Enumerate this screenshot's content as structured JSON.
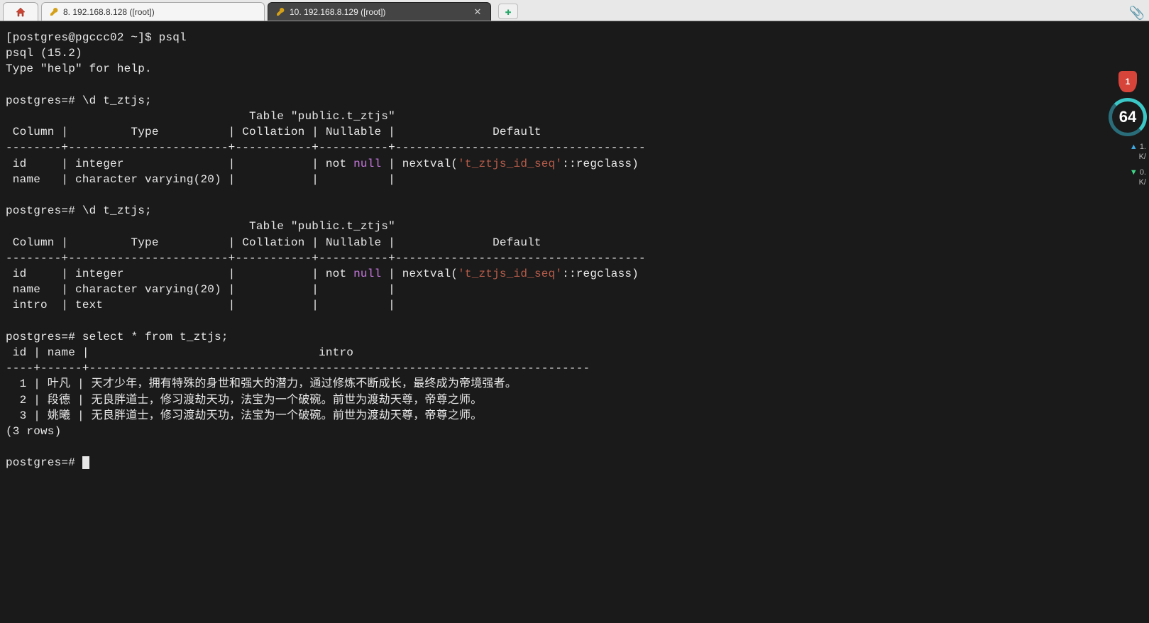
{
  "tabs": {
    "home_icon": "⌂",
    "t1": {
      "icon": "🔧",
      "label": "8. 192.168.8.128 ([root])"
    },
    "t2": {
      "icon": "🔧",
      "label": "10. 192.168.8.129 ([root])",
      "close": "✕"
    },
    "newtab": "✚",
    "paperclip": "📎"
  },
  "terminal": {
    "shell_prompt": "[postgres@pgccc02 ~]$ psql",
    "psql_ver": "psql (15.2)",
    "help_hint": "Type \"help\" for help.",
    "pg_prompt": "postgres=# ",
    "cmd_d1": "\\d t_ztjs;",
    "tbl_title": "                                   Table \"public.t_ztjs\"",
    "hdr": " Column |         Type          | Collation | Nullable |              Default               ",
    "sep1": "--------+-----------------------+-----------+----------+------------------------------------",
    "r1a_pre": " id     | integer               |           | not ",
    "r1a_null": "null",
    "r1a_post": " | nextval(",
    "r1a_str": "'t_ztjs_id_seq'",
    "r1a_post2": "::regclass)",
    "r1b": " name   | character varying(20) |           |          | ",
    "cmd_d2": "\\d t_ztjs;",
    "r2c": " intro  | text                  |           |          | ",
    "cmd_sel": "select * from t_ztjs;",
    "sel_hdr": " id | name |                                 intro                                  ",
    "sel_sep": "----+------+------------------------------------------------------------------------",
    "row1": "  1 | 叶凡 | 天才少年，拥有特殊的身世和强大的潜力，通过修炼不断成长，最终成为帝境强者。",
    "row2": "  2 | 段德 | 无良胖道士，修习渡劫天功，法宝为一个破碗。前世为渡劫天尊，帝尊之师。",
    "row3": "  3 | 姚曦 | 无良胖道士，修习渡劫天功，法宝为一个破碗。前世为渡劫天尊，帝尊之师。",
    "row_count": "(3 rows)"
  },
  "sidebar": {
    "shield": "1",
    "gauge": "64",
    "up_val": "1.",
    "up_unit": "K/",
    "down_val": "0.",
    "down_unit": "K/"
  }
}
